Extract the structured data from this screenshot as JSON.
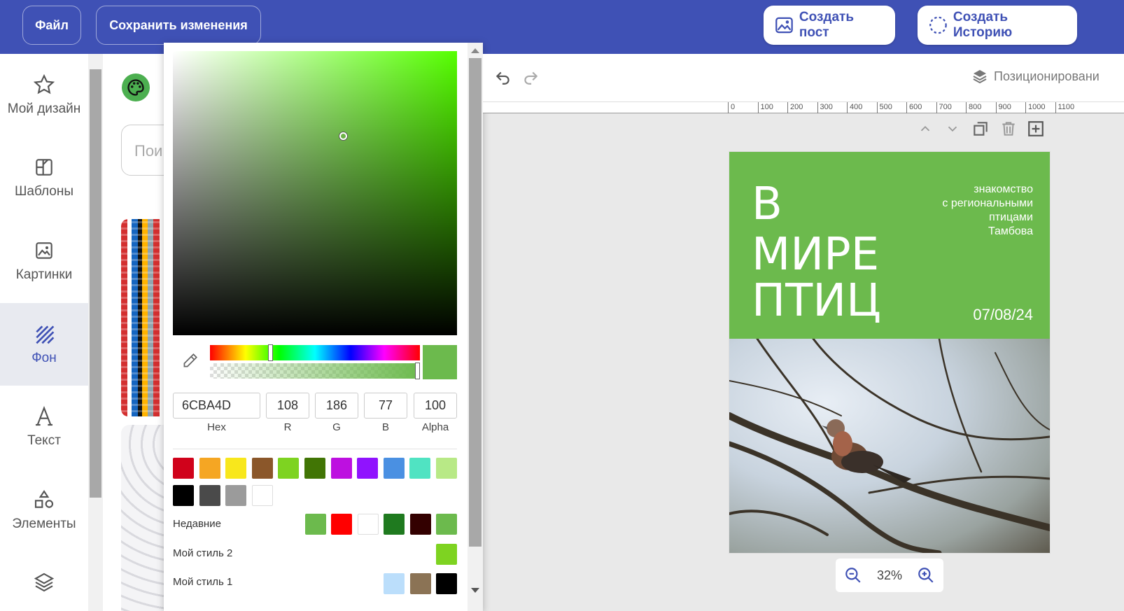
{
  "topbar": {
    "file_label": "Файл",
    "save_label": "Сохранить изменения",
    "create_post_label": "Создать пост",
    "create_story_label": "Создать Историю"
  },
  "sidebar": {
    "items": [
      {
        "label": "Мой дизайн",
        "icon": "star-icon"
      },
      {
        "label": "Шаблоны",
        "icon": "template-icon"
      },
      {
        "label": "Картинки",
        "icon": "image-icon"
      },
      {
        "label": "Фон",
        "icon": "background-icon",
        "active": true
      },
      {
        "label": "Текст",
        "icon": "text-icon"
      },
      {
        "label": "Элементы",
        "icon": "shapes-icon"
      },
      {
        "label": "",
        "icon": "layers-icon"
      }
    ]
  },
  "panel": {
    "search_placeholder": "Пои"
  },
  "picker": {
    "current_color": "#6cba4d",
    "hex": "6CBA4D",
    "r": "108",
    "g": "186",
    "b": "77",
    "alpha": "100",
    "labels": {
      "hex": "Hex",
      "r": "R",
      "g": "G",
      "b": "B",
      "alpha": "Alpha"
    },
    "preset_colors": [
      "#d0021b",
      "#f5a623",
      "#f8e71c",
      "#8b572a",
      "#7ed321",
      "#417505",
      "#bd10e0",
      "#9013fe",
      "#4a90e2",
      "#50e3c2",
      "#b8e986",
      "#000000",
      "#4a4a4a",
      "#9b9b9b",
      "#ffffff"
    ],
    "recent_label": "Недавние",
    "recent_colors": [
      "#6cba4d",
      "#ff0000",
      "#ffffff",
      "#1f7a1f",
      "#330000",
      "#6cba4d"
    ],
    "style2_label": "Мой стиль 2",
    "style2_colors": [
      "#7ed321"
    ],
    "style1_label": "Мой стиль 1",
    "style1_colors": [
      "#bbdefb",
      "#8b7355",
      "#000000"
    ]
  },
  "toolbar2": {
    "position_label": "Позиционировани"
  },
  "ruler": {
    "ticks": [
      "0",
      "100",
      "200",
      "300",
      "400",
      "500",
      "600",
      "700",
      "800",
      "900",
      "1000",
      "1100"
    ]
  },
  "card": {
    "title_line1": "В",
    "title_line2": "МИРЕ",
    "title_line3": "ПТИЦ",
    "sub_line1": "знакомство",
    "sub_line2": "с региональными",
    "sub_line3": "птицами",
    "sub_line4": "Тамбова",
    "date": "07/08/24"
  },
  "zoom": {
    "level": "32%"
  }
}
